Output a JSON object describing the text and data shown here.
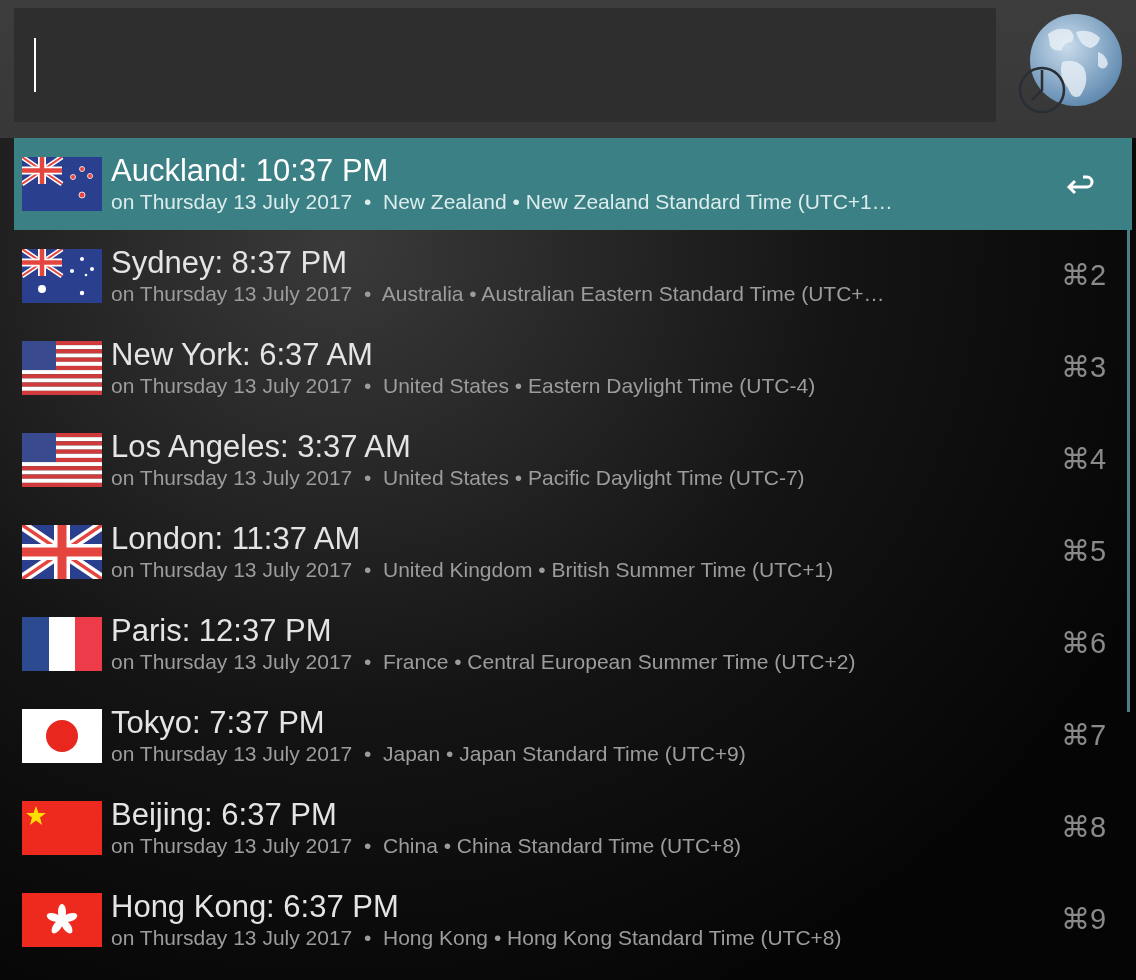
{
  "results": [
    {
      "kind": "nz",
      "title": "Auckland: 10:37 PM",
      "subtitle": "on Thursday 13 July 2017  •  New Zealand • New Zealand Standard Time (UTC+1…",
      "selected": true
    },
    {
      "kind": "au",
      "title": "Sydney: 8:37 PM",
      "subtitle": "on Thursday 13 July 2017  •  Australia • Australian Eastern Standard Time (UTC+…",
      "selected": false,
      "shortcut": "⌘2"
    },
    {
      "kind": "us",
      "title": "New York: 6:37 AM",
      "subtitle": "on Thursday 13 July 2017  •  United States • Eastern Daylight Time (UTC-4)",
      "selected": false,
      "shortcut": "⌘3"
    },
    {
      "kind": "us",
      "title": "Los Angeles: 3:37 AM",
      "subtitle": "on Thursday 13 July 2017  •  United States • Pacific Daylight Time (UTC-7)",
      "selected": false,
      "shortcut": "⌘4"
    },
    {
      "kind": "gb",
      "title": "London: 11:37 AM",
      "subtitle": "on Thursday 13 July 2017  •  United Kingdom • British Summer Time (UTC+1)",
      "selected": false,
      "shortcut": "⌘5"
    },
    {
      "kind": "fr",
      "title": "Paris: 12:37 PM",
      "subtitle": "on Thursday 13 July 2017  •  France • Central European Summer Time (UTC+2)",
      "selected": false,
      "shortcut": "⌘6"
    },
    {
      "kind": "jp",
      "title": "Tokyo: 7:37 PM",
      "subtitle": "on Thursday 13 July 2017  •  Japan • Japan Standard Time (UTC+9)",
      "selected": false,
      "shortcut": "⌘7"
    },
    {
      "kind": "cn",
      "title": "Beijing: 6:37 PM",
      "subtitle": "on Thursday 13 July 2017  •  China • China Standard Time (UTC+8)",
      "selected": false,
      "shortcut": "⌘8"
    },
    {
      "kind": "hk",
      "title": "Hong Kong: 6:37 PM",
      "subtitle": "on Thursday 13 July 2017  •  Hong Kong • Hong Kong Standard Time (UTC+8)",
      "selected": false,
      "shortcut": "⌘9"
    }
  ]
}
